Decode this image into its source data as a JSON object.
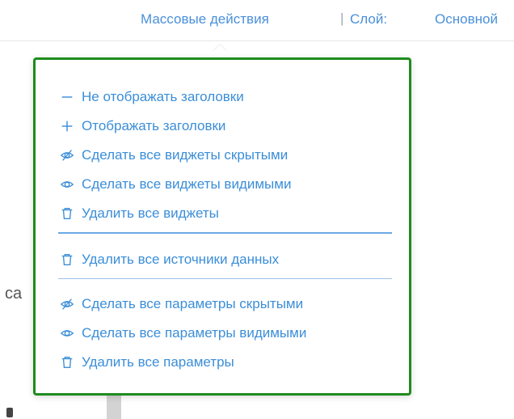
{
  "header": {
    "mass_actions": "Массовые действия",
    "separator": "|",
    "layer_label": "Слой:",
    "layer_value": "Основной"
  },
  "background": {
    "partial_text": "са"
  },
  "menu": {
    "widgets": [
      {
        "icon": "minus-icon",
        "label": "Не отображать заголовки"
      },
      {
        "icon": "plus-icon",
        "label": "Отображать заголовки"
      },
      {
        "icon": "eye-off-icon",
        "label": "Сделать все виджеты скрытыми"
      },
      {
        "icon": "eye-icon",
        "label": "Сделать все виджеты видимыми"
      },
      {
        "icon": "trash-icon",
        "label": "Удалить все виджеты"
      }
    ],
    "datasources": [
      {
        "icon": "trash-icon",
        "label": "Удалить все источники данных"
      }
    ],
    "parameters": [
      {
        "icon": "eye-off-icon",
        "label": "Сделать все параметры скрытыми"
      },
      {
        "icon": "eye-icon",
        "label": "Сделать все параметры видимыми"
      },
      {
        "icon": "trash-icon",
        "label": "Удалить все параметры"
      }
    ]
  },
  "colors": {
    "link_blue": "#3b8ed8",
    "focus_border": "#1e8c1e",
    "divider": "#6aa8e4"
  }
}
